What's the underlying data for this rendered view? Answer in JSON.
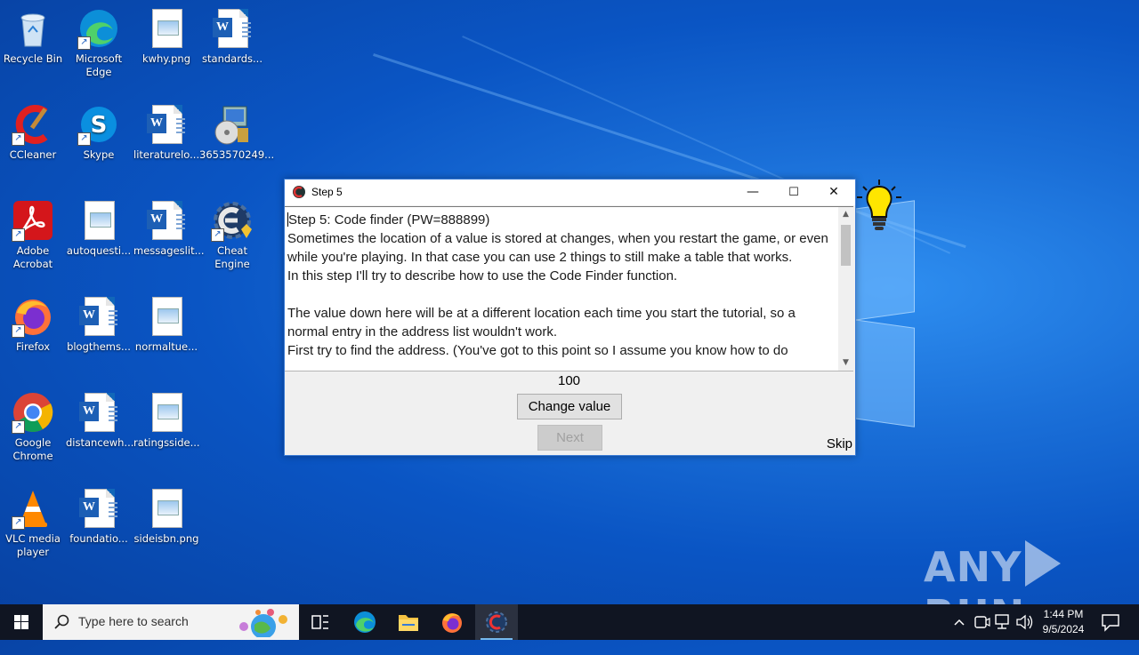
{
  "desktop": {
    "icons": [
      {
        "label": "Recycle Bin"
      },
      {
        "label": "Microsoft Edge"
      },
      {
        "label": "kwhy.png"
      },
      {
        "label": "standards..."
      },
      {
        "label": "CCleaner"
      },
      {
        "label": "Skype"
      },
      {
        "label": "literaturelo..."
      },
      {
        "label": "3653570249..."
      },
      {
        "label": "Adobe Acrobat"
      },
      {
        "label": "autoquesti..."
      },
      {
        "label": "messageslit..."
      },
      {
        "label": "Cheat Engine"
      },
      {
        "label": "Firefox"
      },
      {
        "label": "blogthems..."
      },
      {
        "label": "normaltue..."
      },
      {
        "label": "Google Chrome"
      },
      {
        "label": "distancewh..."
      },
      {
        "label": "ratingsside..."
      },
      {
        "label": "VLC media player"
      },
      {
        "label": "foundatio..."
      },
      {
        "label": "sideisbn.png"
      }
    ]
  },
  "dialog": {
    "title": "Step 5",
    "minimize_glyph": "—",
    "maximize_glyph": "☐",
    "close_glyph": "✕",
    "text": "Step 5: Code finder (PW=888899)\nSometimes the location of a value is stored at changes, when you restart the game, or even while you're playing. In that case you can use 2 things to still make a table that works.\nIn this step I'll try to describe how to use the Code Finder function.\n\nThe value down here will be at a different location each time you start the tutorial, so a normal entry in the address list wouldn't work.\nFirst try to find the address. (You've got to this point so I assume you know how to do",
    "value": "100",
    "change_button": "Change value",
    "next_button": "Next",
    "skip_label": "Skip"
  },
  "taskbar": {
    "search_placeholder": "Type here to search",
    "time": "1:44 PM",
    "date": "9/5/2024",
    "apps": [
      "task-view",
      "edge",
      "file-explorer",
      "firefox",
      "cheat-engine"
    ]
  },
  "watermark": {
    "left": "ANY",
    "right": "RUN"
  }
}
